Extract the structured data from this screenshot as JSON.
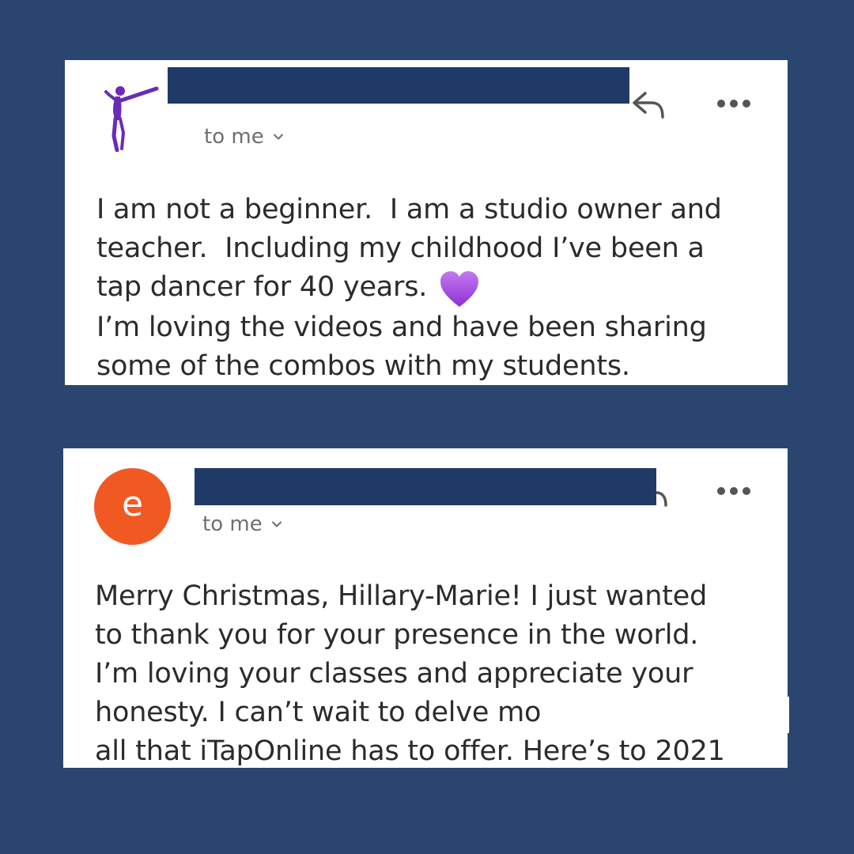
{
  "emails": [
    {
      "sender_logo": "dancer-logo-icon",
      "to_label": "to me",
      "body_lines": [
        "I am not a beginner.  I am a studio owner and",
        "teacher.  Including my childhood I’ve been a",
        "tap dancer for 40 years.",
        "I’m loving the videos and have been sharing",
        "some of the combos with my students."
      ],
      "inline_icon": "purple-heart-icon"
    },
    {
      "avatar_letter": "e",
      "to_label": "to me",
      "body_lines": [
        "Merry Christmas, Hillary-Marie! I just wanted",
        "to thank you for your presence in the world.",
        "I’m loving your classes and appreciate your",
        "honesty. I can’t wait to delve mo",
        "all that iTapOnline has to offer. Here’s to 2021"
      ]
    }
  ],
  "colors": {
    "background": "#2a4670",
    "redaction": "#1f3a67",
    "avatar": "#f05a22",
    "logo": "#6a2bb8",
    "heart": "#a64ee0"
  }
}
